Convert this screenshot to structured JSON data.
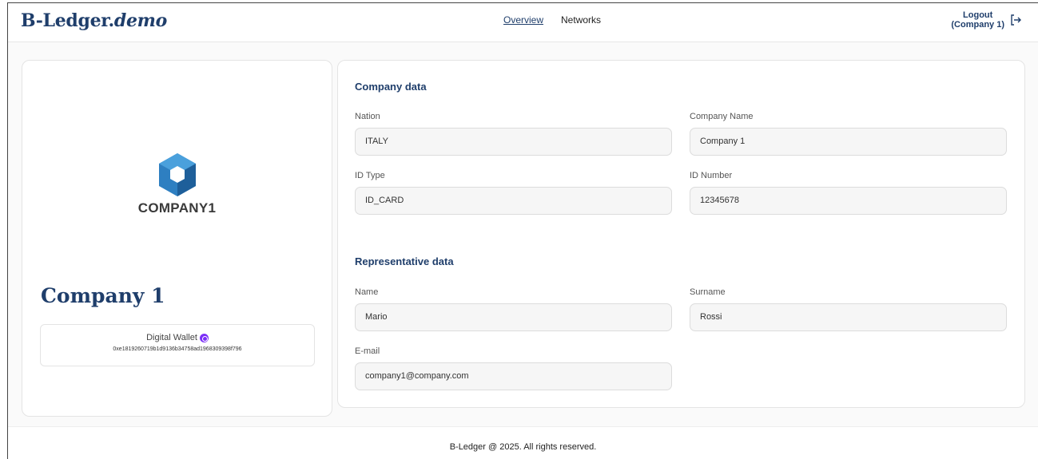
{
  "header": {
    "brand_main": "B-Ledger.",
    "brand_demo": "demo",
    "nav": [
      {
        "label": "Overview",
        "active": true
      },
      {
        "label": "Networks",
        "active": false
      }
    ],
    "logout_line1": "Logout",
    "logout_line2": "(Company 1)",
    "logout_icon": "logout-icon"
  },
  "profile": {
    "logo_text": "COMPANY1",
    "company_name": "Company 1",
    "wallet_label": "Digital Wallet",
    "wallet_badge_icon": "polygon-badge-icon",
    "wallet_address": "0xe1819260719b1d9136b34758ad1968309398f796"
  },
  "company_data": {
    "title": "Company data",
    "fields": {
      "nation": {
        "label": "Nation",
        "value": "ITALY"
      },
      "company_name": {
        "label": "Company Name",
        "value": "Company 1"
      },
      "id_type": {
        "label": "ID Type",
        "value": "ID_CARD"
      },
      "id_number": {
        "label": "ID Number",
        "value": "12345678"
      }
    }
  },
  "representative_data": {
    "title": "Representative data",
    "fields": {
      "name": {
        "label": "Name",
        "value": "Mario"
      },
      "surname": {
        "label": "Surname",
        "value": "Rossi"
      },
      "email": {
        "label": "E-mail",
        "value": "company1@company.com"
      }
    }
  },
  "footer": {
    "text": "B-Ledger @ 2025. All rights reserved."
  },
  "colors": {
    "brand": "#1f3e6b",
    "logo_blue": "#2e7fc1",
    "badge_purple": "#7b2ff7"
  }
}
